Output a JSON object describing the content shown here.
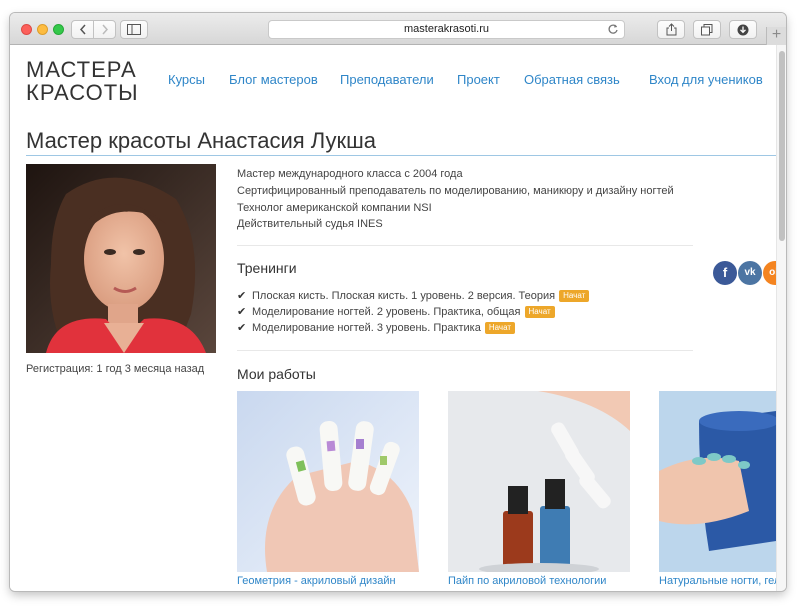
{
  "browser": {
    "url": "masterakrasoti.ru"
  },
  "site": {
    "logo_line1": "МАСТЕРА",
    "logo_line2": "КРАСОТЫ",
    "nav": [
      "Курсы",
      "Блог мастеров",
      "Преподаватели",
      "Проект",
      "Обратная связь",
      "Вход для учеников"
    ]
  },
  "profile": {
    "title": "Мастер красоты Анастасия Лукша",
    "registration": "Регистрация: 1 год 3 месяца назад",
    "info": [
      "Мастер международного класса с 2004 года",
      "Сертифицированный преподаватель по моделированию, маникюру и дизайну ногтей",
      "Технолог американской компании NSI",
      "Действительный судья INES"
    ]
  },
  "trainings": {
    "heading": "Тренинги",
    "items": [
      {
        "label": "Плоская кисть. Плоская кисть. 1 уровень. 2 версия. Теория",
        "badge": "Начат"
      },
      {
        "label": "Моделирование ногтей. 2 уровень. Практика, общая",
        "badge": "Начат"
      },
      {
        "label": "Моделирование ногтей. 3 уровень. Практика",
        "badge": "Начат"
      }
    ]
  },
  "social": {
    "fb": "f",
    "vk": "vk",
    "ok": "ok"
  },
  "works": {
    "heading": "Мои работы",
    "items": [
      {
        "caption": "Геометрия - акриловый дизайн"
      },
      {
        "caption": "Пайп по акриловой технологии"
      },
      {
        "caption": "Натуральные ногти, гель"
      }
    ]
  },
  "colors": {
    "link": "#2f86c8",
    "badge": "#eda72a",
    "title_rule": "#9ec7e4"
  }
}
